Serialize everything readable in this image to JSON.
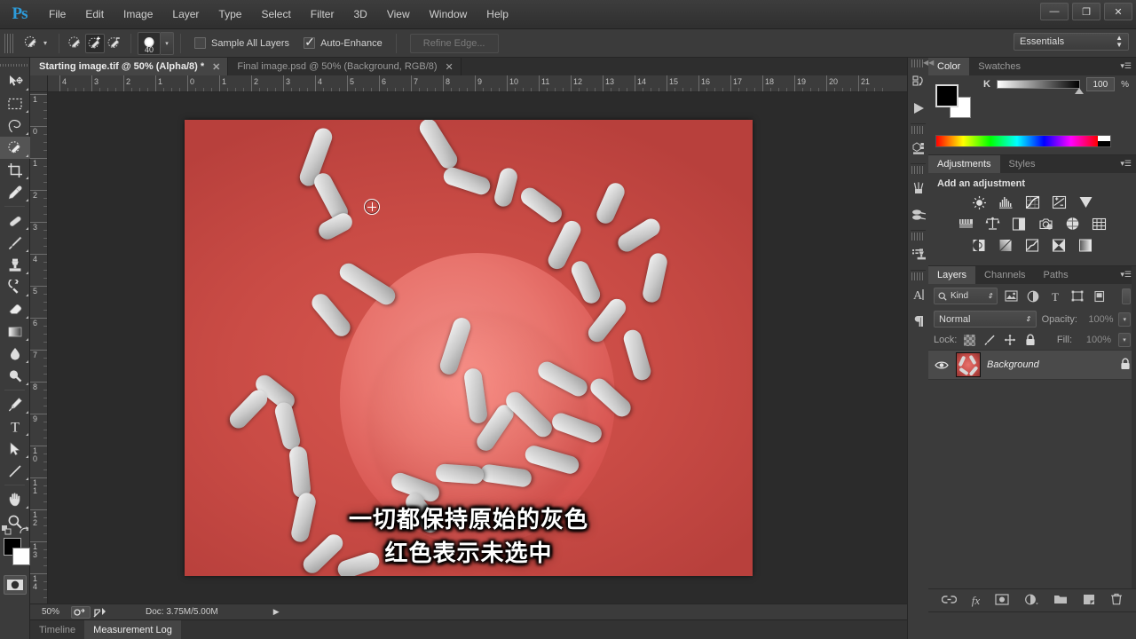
{
  "app": {
    "logo": "Ps",
    "workspace": "Essentials"
  },
  "menus": [
    "File",
    "Edit",
    "Image",
    "Layer",
    "Type",
    "Select",
    "Filter",
    "3D",
    "View",
    "Window",
    "Help"
  ],
  "window_controls": [
    {
      "name": "minimize",
      "glyph": "—"
    },
    {
      "name": "maximize",
      "glyph": "❐"
    },
    {
      "name": "close",
      "glyph": "✕"
    }
  ],
  "options_bar": {
    "brush_size": "40",
    "sample_all_layers": {
      "label": "Sample All Layers",
      "checked": false
    },
    "auto_enhance": {
      "label": "Auto-Enhance",
      "checked": true
    },
    "refine_edge": {
      "label": "Refine Edge...",
      "enabled": false
    },
    "modes": [
      "new-selection",
      "add-to-selection",
      "subtract-from-selection"
    ],
    "active_mode": "add-to-selection"
  },
  "toolbar": {
    "tools": [
      {
        "name": "move-tool",
        "active": false
      },
      {
        "name": "rectangular-marquee-tool",
        "active": false
      },
      {
        "name": "lasso-tool",
        "active": false
      },
      {
        "name": "quick-selection-tool",
        "active": true
      },
      {
        "name": "crop-tool",
        "active": false
      },
      {
        "name": "eyedropper-tool",
        "active": false
      },
      {
        "name": "spot-healing-brush-tool",
        "active": false
      },
      {
        "name": "brush-tool",
        "active": false
      },
      {
        "name": "clone-stamp-tool",
        "active": false
      },
      {
        "name": "history-brush-tool",
        "active": false
      },
      {
        "name": "eraser-tool",
        "active": false
      },
      {
        "name": "gradient-tool",
        "active": false
      },
      {
        "name": "blur-tool",
        "active": false
      },
      {
        "name": "dodge-tool",
        "active": false
      },
      {
        "name": "pen-tool",
        "active": false
      },
      {
        "name": "horizontal-type-tool",
        "active": false
      },
      {
        "name": "path-selection-tool",
        "active": false
      },
      {
        "name": "line-tool",
        "active": false
      },
      {
        "name": "hand-tool",
        "active": false
      },
      {
        "name": "zoom-tool",
        "active": false
      }
    ],
    "foreground_color": "#000000",
    "background_color": "#ffffff"
  },
  "document_tabs": [
    {
      "label": "Starting image.tif @ 50% (Alpha/8) *",
      "active": true
    },
    {
      "label": "Final image.psd @ 50% (Background, RGB/8)",
      "active": false
    }
  ],
  "rulers": {
    "horizontal": [
      "4",
      "3",
      "2",
      "1",
      "0",
      "1",
      "2",
      "3",
      "4",
      "5",
      "6",
      "7",
      "8",
      "9",
      "10",
      "11",
      "12",
      "13",
      "14",
      "15",
      "16",
      "17",
      "18",
      "19",
      "20",
      "21"
    ],
    "vertical": [
      "1",
      "0",
      "1",
      "2",
      "3",
      "4",
      "5",
      "6",
      "7",
      "8",
      "9",
      "10",
      "11",
      "12",
      "13",
      "14"
    ]
  },
  "canvas": {
    "subtitle_line1": "一切都保持原始的灰色",
    "subtitle_line2": "红色表示未选中",
    "mask_color": "#d6534f",
    "cursor": "brush-circle-crosshair"
  },
  "status_bar": {
    "zoom": "50%",
    "doc_info": "Doc: 3.75M/5.00M"
  },
  "bottom_tabs": [
    {
      "label": "Timeline",
      "active": false
    },
    {
      "label": "Measurement Log",
      "active": true
    }
  ],
  "icon_dock": [
    {
      "name": "history-icon"
    },
    {
      "name": "actions-play-icon"
    },
    {
      "name": "3d-icon"
    },
    {
      "name": "brush-icon"
    },
    {
      "name": "brush-presets-icon"
    },
    {
      "name": "clone-source-icon"
    },
    {
      "name": "character-icon"
    },
    {
      "name": "paragraph-icon"
    }
  ],
  "color_panel": {
    "tabs": [
      {
        "label": "Color",
        "active": true
      },
      {
        "label": "Swatches",
        "active": false
      }
    ],
    "channel_label": "K",
    "channel_value": "100",
    "unit": "%",
    "foreground": "#000000",
    "background": "#ffffff"
  },
  "adjustments_panel": {
    "tabs": [
      {
        "label": "Adjustments",
        "active": true
      },
      {
        "label": "Styles",
        "active": false
      }
    ],
    "heading": "Add an adjustment",
    "rows": [
      [
        "brightness-contrast-icon",
        "levels-icon",
        "curves-icon",
        "exposure-icon",
        "vibrance-icon"
      ],
      [
        "hue-saturation-icon",
        "color-balance-icon",
        "black-white-icon",
        "photo-filter-icon",
        "channel-mixer-icon",
        "color-lookup-icon"
      ],
      [
        "invert-icon",
        "posterize-icon",
        "threshold-icon",
        "selective-color-icon",
        "gradient-map-icon"
      ]
    ]
  },
  "layers_panel": {
    "tabs": [
      {
        "label": "Layers",
        "active": true
      },
      {
        "label": "Channels",
        "active": false
      },
      {
        "label": "Paths",
        "active": false
      }
    ],
    "filter_kind": "Kind",
    "filter_icons": [
      "pixel-filter-icon",
      "adjustment-filter-icon",
      "type-filter-icon",
      "shape-filter-icon",
      "smart-object-filter-icon"
    ],
    "blend_mode": "Normal",
    "opacity_label": "Opacity:",
    "opacity_value": "100%",
    "lock_label": "Lock:",
    "lock_icons": [
      "lock-transparency-icon",
      "lock-image-icon",
      "lock-position-icon",
      "lock-all-icon"
    ],
    "fill_label": "Fill:",
    "fill_value": "100%",
    "layers": [
      {
        "name": "Background",
        "visible": true,
        "locked": true
      }
    ],
    "footer_icons": [
      "link-layers-icon",
      "layer-style-fx-icon",
      "add-mask-icon",
      "new-adjustment-icon",
      "new-group-icon",
      "new-layer-icon",
      "delete-layer-icon"
    ]
  }
}
